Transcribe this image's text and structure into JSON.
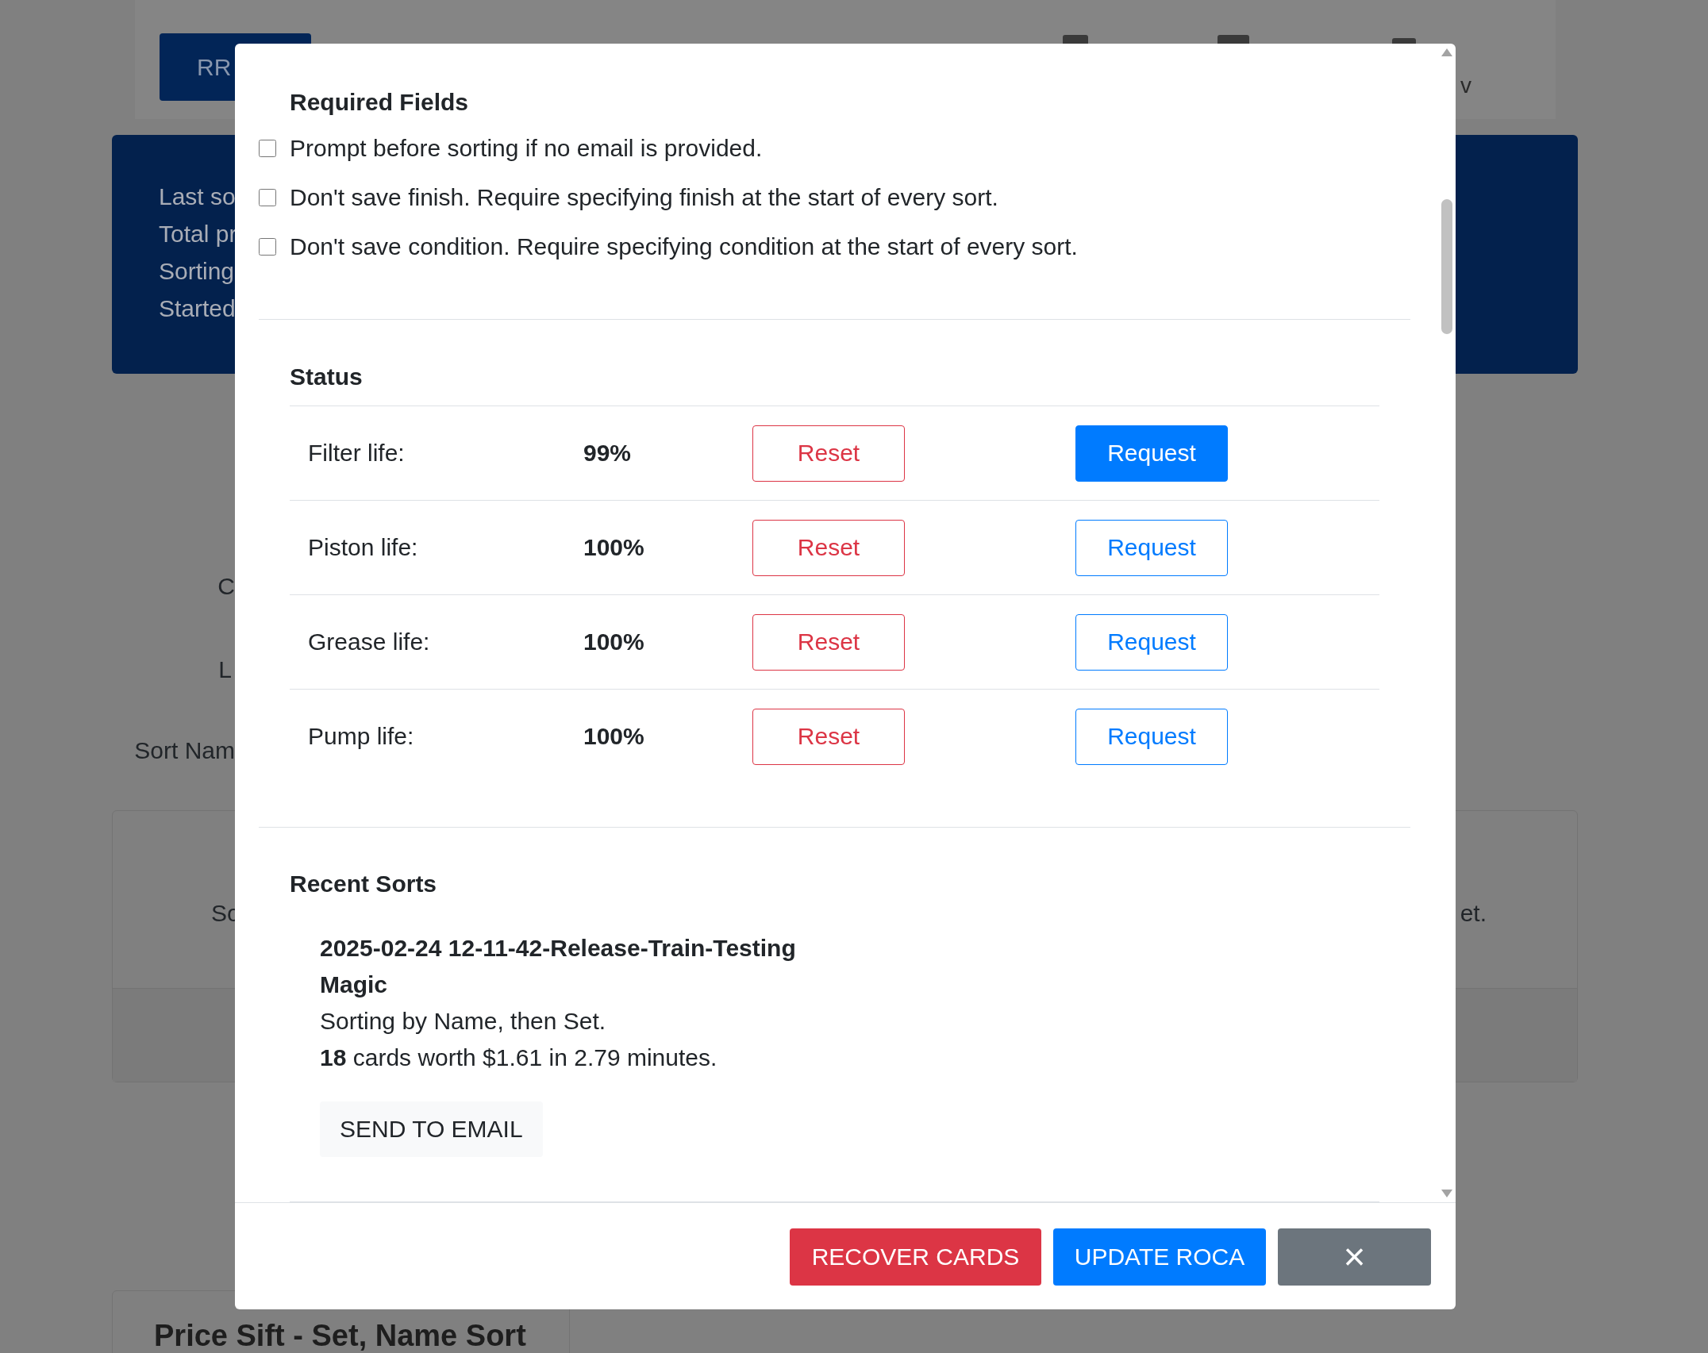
{
  "background": {
    "nav_button": "RR",
    "nav_text": "v",
    "summary_lines": [
      "Last so",
      "Total pr",
      "Sorting",
      "Started"
    ],
    "labels": [
      "C",
      "L",
      "Sort Nam"
    ],
    "card_texts": [
      "So",
      "et."
    ],
    "bottom_card_title": "Price Sift - Set, Name Sort"
  },
  "modal": {
    "required_fields": {
      "title": "Required Fields",
      "options": [
        {
          "label": "Prompt before sorting if no email is provided.",
          "checked": false
        },
        {
          "label": "Don't save finish. Require specifying finish at the start of every sort.",
          "checked": false
        },
        {
          "label": "Don't save condition. Require specifying condition at the start of every sort.",
          "checked": false
        }
      ]
    },
    "status": {
      "title": "Status",
      "rows": [
        {
          "label": "Filter life:",
          "value": "99%",
          "reset": "Reset",
          "request": "Request",
          "selected": true
        },
        {
          "label": "Piston life:",
          "value": "100%",
          "reset": "Reset",
          "request": "Request",
          "selected": false
        },
        {
          "label": "Grease life:",
          "value": "100%",
          "reset": "Reset",
          "request": "Request",
          "selected": false
        },
        {
          "label": "Pump life:",
          "value": "100%",
          "reset": "Reset",
          "request": "Request",
          "selected": false
        }
      ]
    },
    "recent_sorts": {
      "title": "Recent Sorts",
      "items": [
        {
          "name": "2025-02-24 12-11-42-Release-Train-Testing",
          "game": "Magic",
          "sorting": "Sorting by Name, then Set.",
          "summary": "**18** cards worth $1.61 in 2.79 minutes.",
          "button": "SEND TO EMAIL"
        }
      ]
    },
    "footer": {
      "recover": "RECOVER CARDS",
      "update": "UPDATE ROCA",
      "close": "×"
    }
  }
}
